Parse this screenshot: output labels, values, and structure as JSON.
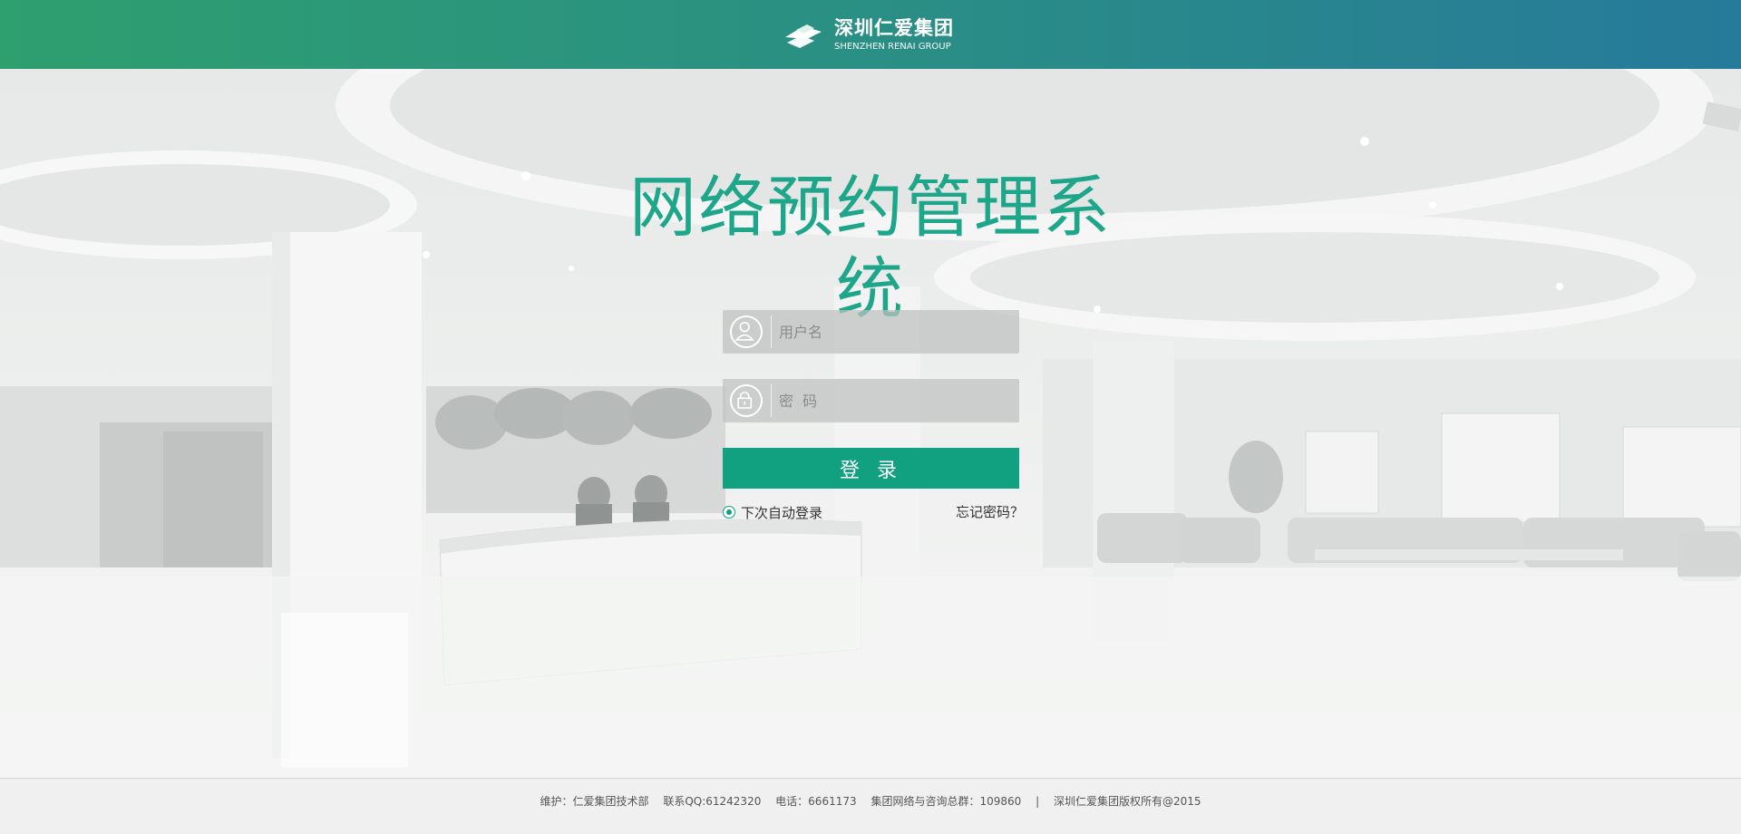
{
  "header": {
    "brand_cn": "深圳仁爱集团",
    "brand_en": "SHENZHEN RENAI GROUP"
  },
  "main": {
    "title": "网络预约管理系统"
  },
  "login": {
    "username_placeholder": "用户名",
    "password_placeholder": "密  码",
    "submit_label": "登 录",
    "remember_label": "下次自动登录",
    "remember_checked": true,
    "forgot_label": "忘记密码？"
  },
  "footer": {
    "maintainer": "维护：仁爱集团技术部",
    "qq": "联系QQ:61242320",
    "phone": "电话：6661173",
    "group": "集团网络与咨询总群：109860",
    "separator": "|",
    "copyright": "深圳仁爱集团版权所有@2015"
  },
  "colors": {
    "header_start": "#2e9f6f",
    "header_end": "#267a9a",
    "accent": "#11a181",
    "title": "#1ea68a"
  },
  "icons": {
    "brand": "renai-logo-icon",
    "user": "user-icon",
    "lock": "lock-icon"
  }
}
